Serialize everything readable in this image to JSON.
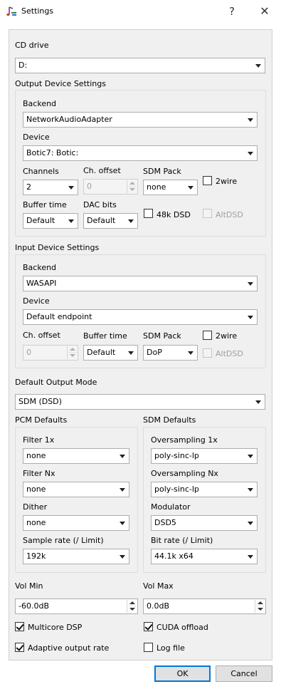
{
  "window": {
    "title": "Settings",
    "help": "?",
    "close": "✕",
    "icon": "app-icon"
  },
  "cd": {
    "label": "CD drive",
    "value": "D:"
  },
  "output": {
    "group": "Output Device Settings",
    "backend_label": "Backend",
    "backend": "NetworkAudioAdapter",
    "device_label": "Device",
    "device": "Botic7: Botic:",
    "channels_label": "Channels",
    "channels": "2",
    "choffset_label": "Ch. offset",
    "choffset": "0",
    "sdmpack_label": "SDM Pack",
    "sdmpack": "none",
    "twowire": "2wire",
    "buffer_label": "Buffer time",
    "buffer": "Default",
    "dacbits_label": "DAC bits",
    "dacbits": "Default",
    "dsd48k": "48k DSD",
    "altdsd": "AltDSD"
  },
  "input": {
    "group": "Input Device Settings",
    "backend_label": "Backend",
    "backend": "WASAPI",
    "device_label": "Device",
    "device": "Default endpoint",
    "choffset_label": "Ch. offset",
    "choffset": "0",
    "buffer_label": "Buffer time",
    "buffer": "Default",
    "sdmpack_label": "SDM Pack",
    "sdmpack": "DoP",
    "twowire": "2wire",
    "altdsd": "AltDSD"
  },
  "mode": {
    "label": "Default Output Mode",
    "value": "SDM (DSD)"
  },
  "pcm": {
    "group": "PCM Defaults",
    "filter1x_label": "Filter 1x",
    "filter1x": "none",
    "filternx_label": "Filter Nx",
    "filternx": "none",
    "dither_label": "Dither",
    "dither": "none",
    "rate_label": "Sample rate (/ Limit)",
    "rate": "192k"
  },
  "sdm": {
    "group": "SDM Defaults",
    "os1x_label": "Oversampling 1x",
    "os1x": "poly-sinc-lp",
    "osnx_label": "Oversampling Nx",
    "osnx": "poly-sinc-lp",
    "mod_label": "Modulator",
    "mod": "DSD5",
    "bitrate_label": "Bit rate (/ Limit)",
    "bitrate": "44.1k x64"
  },
  "vol": {
    "min_label": "Vol Min",
    "min": "-60.0dB",
    "max_label": "Vol Max",
    "max": "0.0dB"
  },
  "opts": {
    "multicore": "Multicore DSP",
    "cuda": "CUDA offload",
    "adaptive": "Adaptive output rate",
    "logfile": "Log file"
  },
  "buttons": {
    "ok": "OK",
    "cancel": "Cancel"
  }
}
